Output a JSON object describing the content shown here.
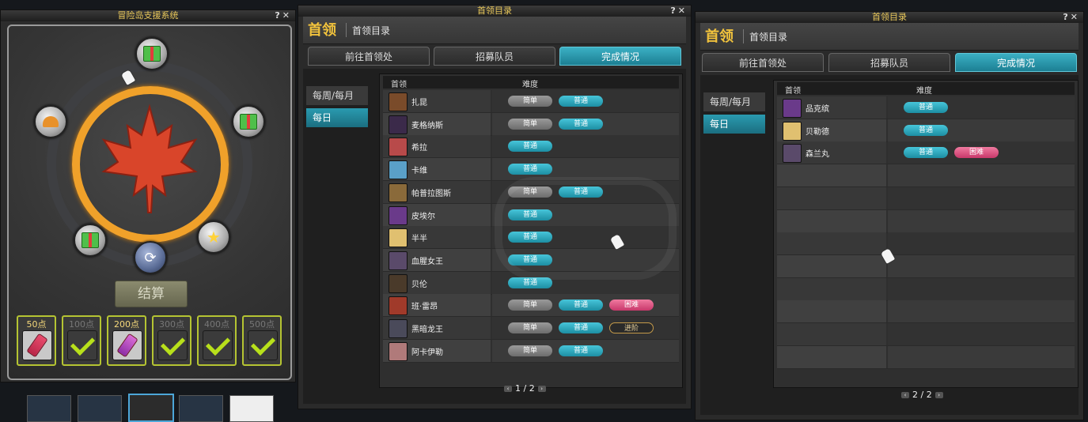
{
  "win1": {
    "title": "冒险岛支援系统",
    "settle_label": "结算",
    "rewards": [
      {
        "label": "50点",
        "done": false,
        "icon": "potion-icon"
      },
      {
        "label": "100点",
        "done": true,
        "icon": "check-icon"
      },
      {
        "label": "200点",
        "done": false,
        "icon": "potion-icon"
      },
      {
        "label": "300点",
        "done": true,
        "icon": "check-icon"
      },
      {
        "label": "400点",
        "done": true,
        "icon": "check-icon"
      },
      {
        "label": "500点",
        "done": true,
        "icon": "check-icon"
      }
    ]
  },
  "boss_windows": [
    {
      "title": "首领目录",
      "heading": "首领",
      "subheading": "首领目录",
      "tabs": [
        "前往首领处",
        "招募队员",
        "完成情况"
      ],
      "active_tab": 2,
      "side": [
        "每周/每月",
        "每日"
      ],
      "active_side": 1,
      "col_boss": "首领",
      "col_difficulty": "难度",
      "page": "1 / 2",
      "rows": [
        {
          "name": "扎昆",
          "diffs": [
            "简单",
            "普通"
          ]
        },
        {
          "name": "麦格纳斯",
          "diffs": [
            "简单",
            "普通"
          ]
        },
        {
          "name": "希拉",
          "diffs": [
            "普通"
          ]
        },
        {
          "name": "卡维",
          "diffs": [
            "普通"
          ]
        },
        {
          "name": "帕普拉图斯",
          "diffs": [
            "简单",
            "普通"
          ]
        },
        {
          "name": "皮埃尔",
          "diffs": [
            "普通"
          ]
        },
        {
          "name": "半半",
          "diffs": [
            "普通"
          ]
        },
        {
          "name": "血腥女王",
          "diffs": [
            "普通"
          ]
        },
        {
          "name": "贝伦",
          "diffs": [
            "普通"
          ]
        },
        {
          "name": "班·雷昂",
          "diffs": [
            "简单",
            "普通",
            "困难"
          ]
        },
        {
          "name": "黑暗龙王",
          "diffs": [
            "简单",
            "普通",
            "进阶"
          ]
        },
        {
          "name": "阿卡伊勒",
          "diffs": [
            "简单",
            "普通"
          ]
        }
      ]
    },
    {
      "title": "首领目录",
      "heading": "首领",
      "subheading": "首领目录",
      "tabs": [
        "前往首领处",
        "招募队员",
        "完成情况"
      ],
      "active_tab": 2,
      "side": [
        "每周/每月",
        "每日"
      ],
      "active_side": 1,
      "col_boss": "首领",
      "col_difficulty": "难度",
      "page": "2 / 2",
      "rows": [
        {
          "name": "品克缤",
          "diffs": [
            "普通"
          ]
        },
        {
          "name": "贝勒德",
          "diffs": [
            "普通"
          ]
        },
        {
          "name": "森兰丸",
          "diffs": [
            "普通",
            "困难"
          ]
        }
      ]
    }
  ]
}
